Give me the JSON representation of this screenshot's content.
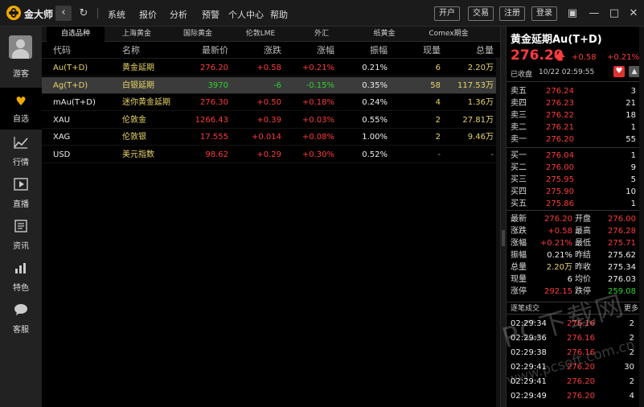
{
  "app": {
    "name": "金大师",
    "menu": [
      "系统",
      "报价",
      "分析",
      "预警",
      "个人中心",
      "帮助"
    ],
    "buttons": {
      "open_account": "开户",
      "trade": "交易",
      "register": "注册",
      "login": "登录"
    },
    "icons": {
      "back": "chevron-left-icon",
      "refresh": "refresh-icon",
      "skin": "tshirt-icon",
      "minimize": "minimize-icon",
      "maximize": "maximize-icon",
      "close": "close-icon"
    }
  },
  "sidebar": {
    "user_label": "游客",
    "items": [
      {
        "label": "自选",
        "icon": "heart-icon",
        "active": true
      },
      {
        "label": "行情",
        "icon": "line-chart-icon",
        "active": false
      },
      {
        "label": "直播",
        "icon": "play-icon",
        "active": false
      },
      {
        "label": "资讯",
        "icon": "news-icon",
        "active": false
      },
      {
        "label": "特色",
        "icon": "bar-chart-icon",
        "active": false
      },
      {
        "label": "客服",
        "icon": "chat-bubble-icon",
        "active": false
      }
    ]
  },
  "tabs": [
    "自选品种",
    "上海黄金",
    "国际黄金",
    "伦敦LME",
    "外汇",
    "纸黄金",
    "Comex期金"
  ],
  "table": {
    "columns": [
      "代码",
      "名称",
      "最新价",
      "涨跌",
      "涨幅",
      "振幅",
      "现量",
      "总量"
    ],
    "rows": [
      {
        "code": "Au(T+D)",
        "name": "黄金延期",
        "last": "276.20",
        "change": "+0.58",
        "pct": "+0.21%",
        "amp": "0.21%",
        "vol": "6",
        "total": "2.20万",
        "dir": "up"
      },
      {
        "code": "Ag(T+D)",
        "name": "白银延期",
        "last": "3970",
        "change": "-6",
        "pct": "-0.15%",
        "amp": "0.35%",
        "vol": "58",
        "total": "117.53万",
        "dir": "down"
      },
      {
        "code": "mAu(T+D)",
        "name": "迷你黄金延期",
        "last": "276.30",
        "change": "+0.50",
        "pct": "+0.18%",
        "amp": "0.24%",
        "vol": "4",
        "total": "1.36万",
        "dir": "up"
      },
      {
        "code": "XAU",
        "name": "伦敦金",
        "last": "1266.43",
        "change": "+0.39",
        "pct": "+0.03%",
        "amp": "0.55%",
        "vol": "2",
        "total": "27.81万",
        "dir": "up"
      },
      {
        "code": "XAG",
        "name": "伦敦银",
        "last": "17.555",
        "change": "+0.014",
        "pct": "+0.08%",
        "amp": "1.00%",
        "vol": "2",
        "total": "9.46万",
        "dir": "up"
      },
      {
        "code": "USD",
        "name": "美元指数",
        "last": "98.62",
        "change": "+0.29",
        "pct": "+0.30%",
        "amp": "0.52%",
        "vol": "-",
        "total": "-",
        "dir": "up"
      }
    ]
  },
  "quote": {
    "title": "黄金延期Au(T+D)",
    "price": "276.20",
    "change": "+0.58",
    "pct": "+0.21%",
    "status": "已收盘",
    "time": "10/22 02:59:55",
    "sell": [
      {
        "label": "卖五",
        "price": "276.24",
        "vol": "3"
      },
      {
        "label": "卖四",
        "price": "276.23",
        "vol": "21"
      },
      {
        "label": "卖三",
        "price": "276.22",
        "vol": "18"
      },
      {
        "label": "卖二",
        "price": "276.21",
        "vol": "1"
      },
      {
        "label": "卖一",
        "price": "276.20",
        "vol": "55"
      }
    ],
    "buy": [
      {
        "label": "买一",
        "price": "276.04",
        "vol": "1"
      },
      {
        "label": "买二",
        "price": "276.00",
        "vol": "9"
      },
      {
        "label": "买三",
        "price": "275.95",
        "vol": "5"
      },
      {
        "label": "买四",
        "price": "275.90",
        "vol": "10"
      },
      {
        "label": "买五",
        "price": "275.86",
        "vol": "1"
      }
    ],
    "stats": [
      {
        "l1": "最新",
        "v1": "276.20",
        "c1": "red",
        "l2": "开盘",
        "v2": "276.00",
        "c2": "red"
      },
      {
        "l1": "涨跌",
        "v1": "+0.58",
        "c1": "red",
        "l2": "最高",
        "v2": "276.28",
        "c2": "red"
      },
      {
        "l1": "涨幅",
        "v1": "+0.21%",
        "c1": "red",
        "l2": "最低",
        "v2": "275.71",
        "c2": "red"
      },
      {
        "l1": "振幅",
        "v1": "0.21%",
        "c1": "white",
        "l2": "昨结",
        "v2": "275.62",
        "c2": "white"
      },
      {
        "l1": "总量",
        "v1": "2.20万",
        "c1": "yellow",
        "l2": "昨收",
        "v2": "275.34",
        "c2": "white"
      },
      {
        "l1": "现量",
        "v1": "6",
        "c1": "white",
        "l2": "均价",
        "v2": "276.03",
        "c2": "white"
      },
      {
        "l1": "涨停",
        "v1": "292.15",
        "c1": "red",
        "l2": "跌停",
        "v2": "259.08",
        "c2": "green"
      }
    ],
    "ticks_title": "逐笔成交",
    "ticks_more": "更多",
    "ticks": [
      {
        "time": "02:29:34",
        "price": "276.16",
        "vol": "2"
      },
      {
        "time": "02:29:36",
        "price": "276.16",
        "vol": "2"
      },
      {
        "time": "02:29:38",
        "price": "276.16",
        "vol": "2"
      },
      {
        "time": "02:29:41",
        "price": "276.20",
        "vol": "30"
      },
      {
        "time": "02:29:41",
        "price": "276.20",
        "vol": "2"
      },
      {
        "time": "02:29:49",
        "price": "276.20",
        "vol": "4"
      }
    ]
  },
  "watermark": {
    "text": "PC下载网",
    "url": "www.pcsoft.com.cn"
  },
  "colors": {
    "up": "#ff3b3b",
    "down": "#2ed22e",
    "accent": "#f2a900",
    "name_yellow": "#e9d56a"
  }
}
